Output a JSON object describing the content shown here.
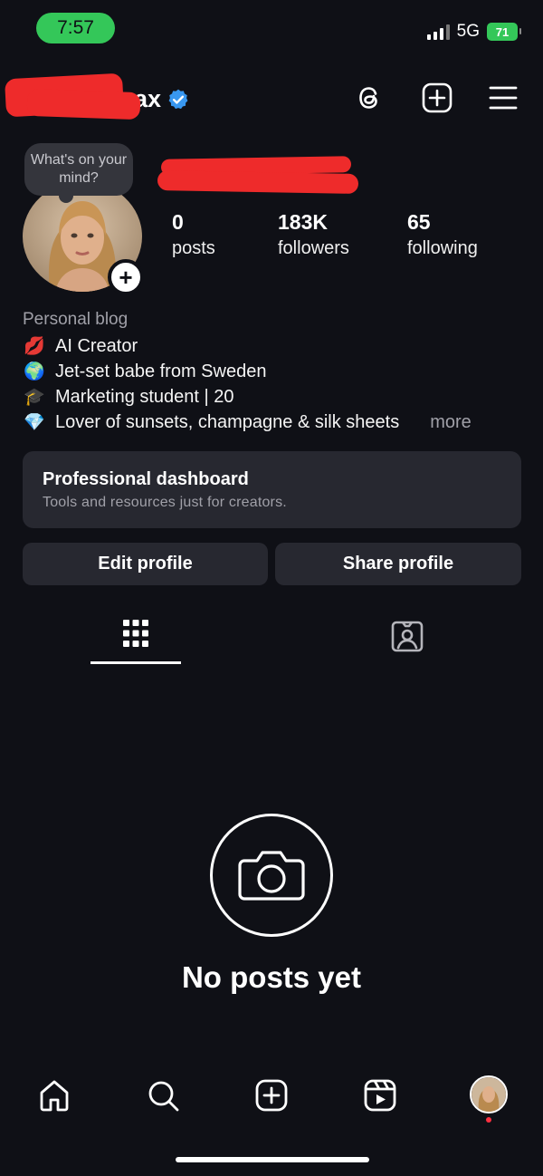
{
  "status_bar": {
    "time": "7:57",
    "network": "5G",
    "battery": "71"
  },
  "header": {
    "username": "ax",
    "icons": [
      "threads-icon",
      "create-icon",
      "menu-icon"
    ]
  },
  "profile": {
    "bubble_text": "What's on your mind?",
    "stats": [
      {
        "value": "0",
        "label": "posts"
      },
      {
        "value": "183K",
        "label": "followers"
      },
      {
        "value": "65",
        "label": "following"
      }
    ]
  },
  "bio": {
    "category": "Personal blog",
    "lines": [
      {
        "emoji": "💋",
        "text": "AI Creator"
      },
      {
        "emoji": "🌍",
        "text": "Jet-set babe from Sweden"
      },
      {
        "emoji": "🎓",
        "text": "Marketing student | 20"
      },
      {
        "emoji": "💎",
        "text": "Lover of sunsets, champagne & silk sheets"
      }
    ],
    "more": "more"
  },
  "dashboard": {
    "title": "Professional dashboard",
    "subtitle": "Tools and resources just for creators."
  },
  "actions": {
    "edit": "Edit profile",
    "share": "Share profile"
  },
  "empty_state": {
    "title": "No posts yet"
  },
  "colors": {
    "background": "#0f1016",
    "card": "#272830",
    "status_green": "#34c759",
    "verified_blue": "#3897f0",
    "redaction": "#ee2b2b"
  }
}
